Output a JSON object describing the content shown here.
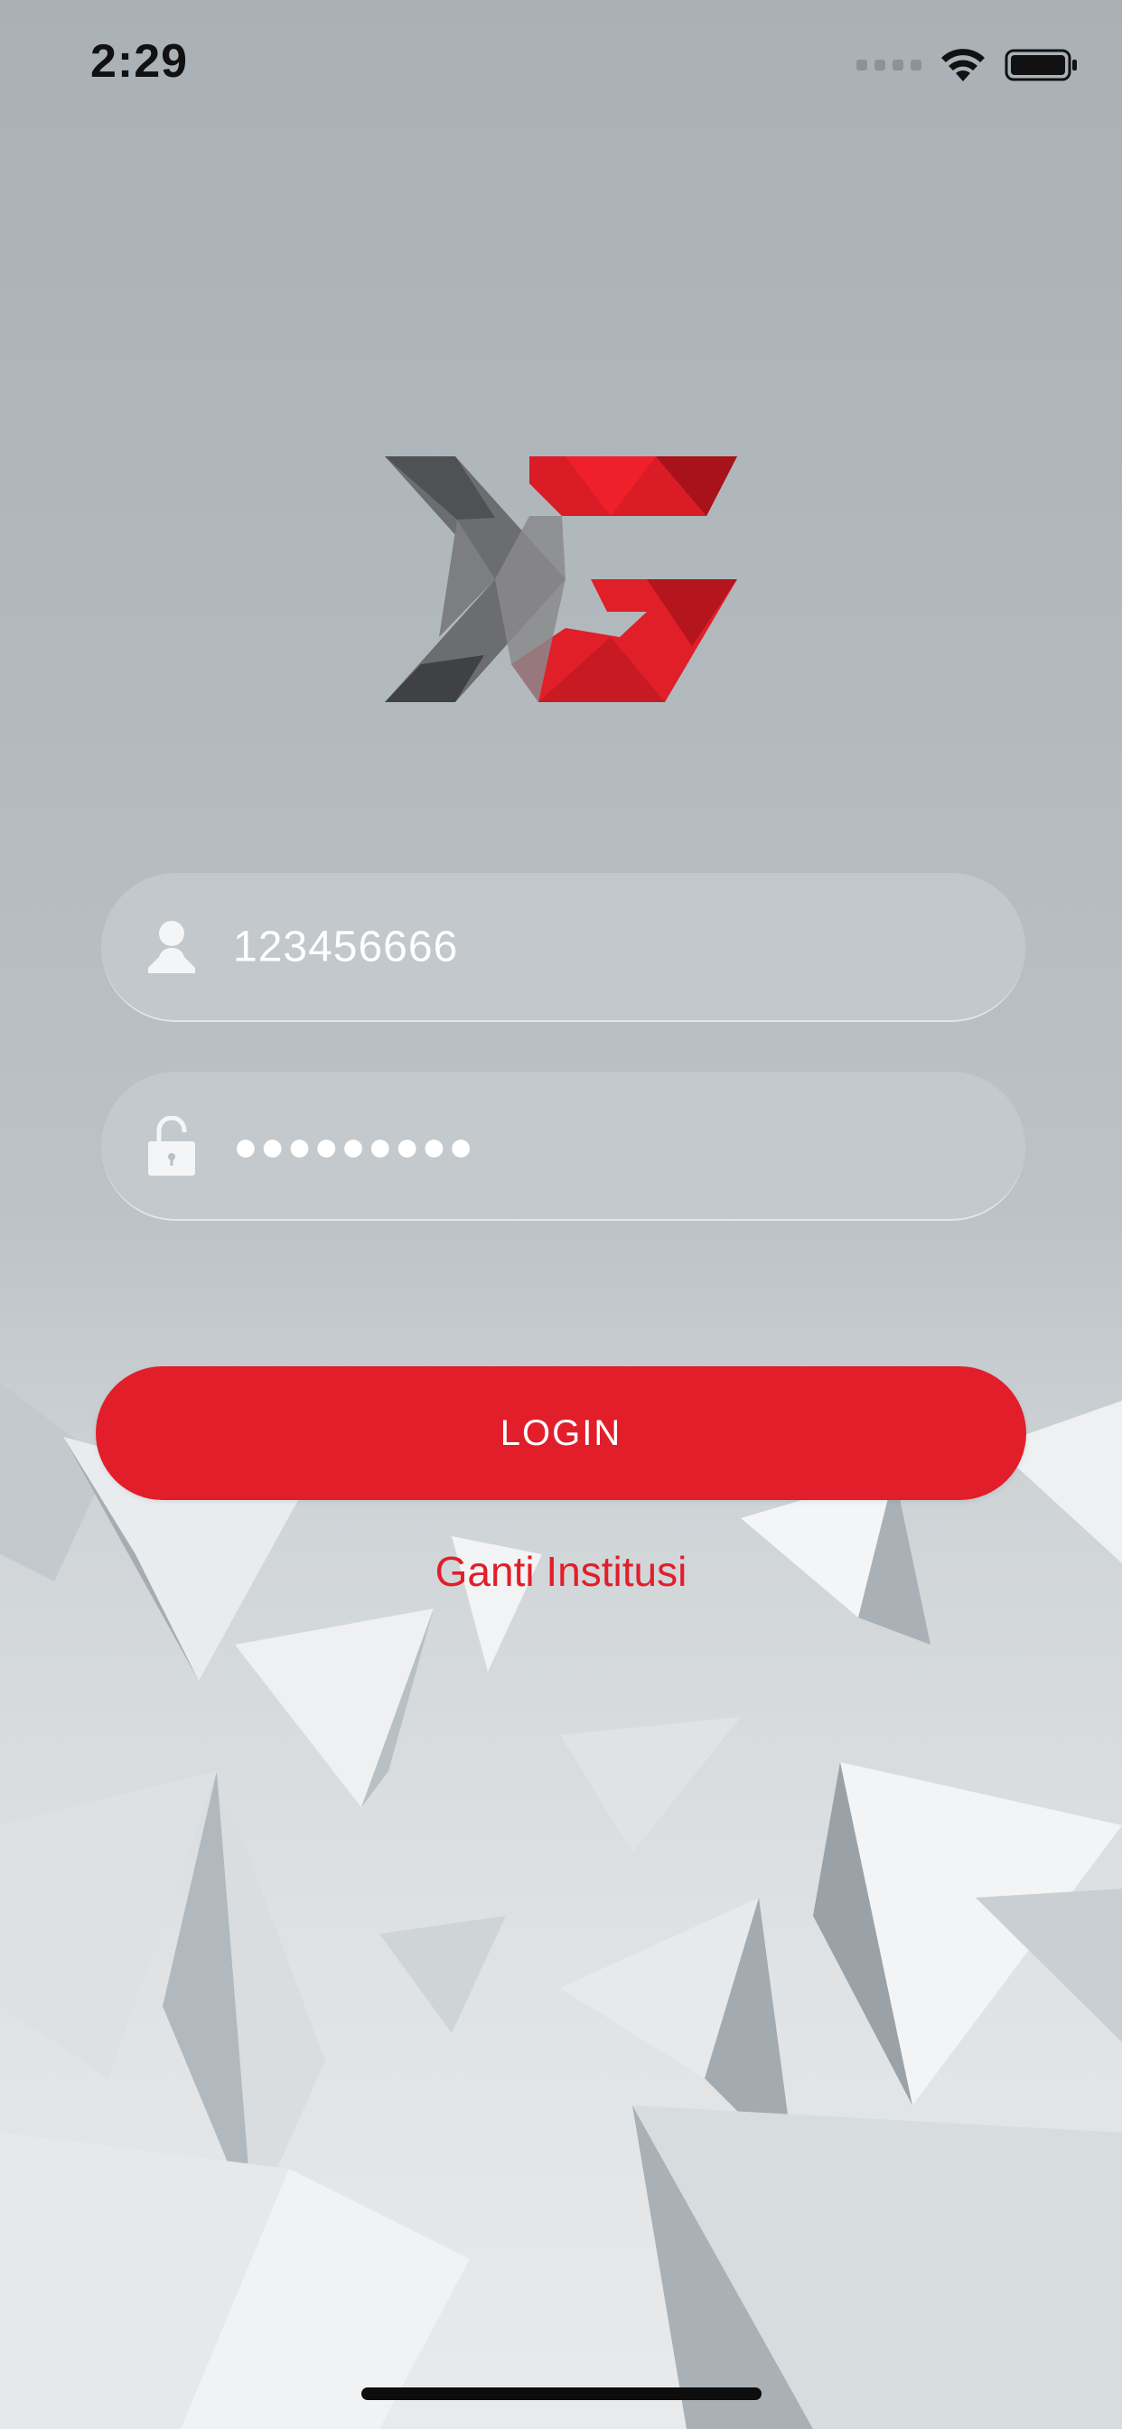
{
  "status_bar": {
    "time": "2:29",
    "icons": [
      "signal-icon",
      "wifi-icon",
      "battery-icon"
    ]
  },
  "logo": {
    "icon": "xg-logo-icon"
  },
  "login_form": {
    "username": {
      "icon": "user-icon",
      "value": "123456666"
    },
    "password": {
      "icon": "unlock-icon",
      "value": "●●●●●●●●●"
    },
    "login_label": "LOGIN",
    "change_institution_label": "Ganti Institusi"
  },
  "colors": {
    "accent": "#e11e2a",
    "field_background": "#c6ccce",
    "text_on_field": "#ffffff"
  }
}
